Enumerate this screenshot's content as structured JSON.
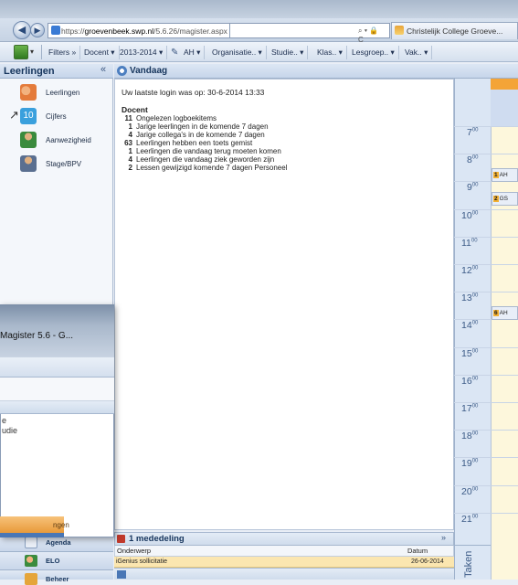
{
  "browser": {
    "url_prefix": "https://",
    "url_domain": "groevenbeek.swp.nl",
    "url_path": "/5.6.26/magister.aspx",
    "url_tools": "⌕ ▾ 🔒 C",
    "tab_title": "Christelijk College Groeve..."
  },
  "toolbar": {
    "items": [
      "Filters »",
      "Docent ▾",
      "2013-2014 ▾",
      "AH ▾",
      "Organisatie.. ▾",
      "Studie.. ▾",
      "Klas.. ▾",
      "Lesgroep.. ▾",
      "Vak.. ▾"
    ]
  },
  "sidebar": {
    "title": "Leerlingen",
    "collapse": "«",
    "items": [
      {
        "label": "Leerlingen",
        "icon": "students-icon",
        "color": "#e47b3b"
      },
      {
        "label": "Cijfers",
        "icon": "grades-icon",
        "color": "#3aa0dd"
      },
      {
        "label": "Aanwezigheid",
        "icon": "attendance-icon",
        "color": "#3a8b3d"
      },
      {
        "label": "Stage/BPV",
        "icon": "internship-icon",
        "color": "#5a6f90"
      }
    ],
    "bottom": [
      {
        "label": "Agenda",
        "icon": "calendar-icon"
      },
      {
        "label": "ELO",
        "icon": "elo-icon"
      },
      {
        "label": "Beheer",
        "icon": "admin-icon"
      }
    ]
  },
  "main": {
    "title": "Vandaag",
    "last_login": "Uw laatste login was op: 30-6-2014 13:33",
    "section": "Docent",
    "stats": [
      {
        "n": "11",
        "text": "Ongelezen logboekitems"
      },
      {
        "n": "1",
        "text": "Jarige leerlingen in de komende 7 dagen"
      },
      {
        "n": "4",
        "text": "Jarige collega's in de komende 7 dagen"
      },
      {
        "n": "63",
        "text": "Leerlingen hebben een toets gemist"
      },
      {
        "n": "1",
        "text": "Leerlingen die vandaag terug moeten komen"
      },
      {
        "n": "4",
        "text": "Leerlingen die vandaag ziek geworden zijn"
      },
      {
        "n": "2",
        "text": "Lessen gewijzigd komende 7 dagen Personeel"
      }
    ]
  },
  "mededeling": {
    "title": "1 mededeling",
    "col_subject": "Onderwerp",
    "col_date": "Datum",
    "rows": [
      {
        "subject": "iGenius sollicitatie",
        "date": "26-06-2014"
      }
    ]
  },
  "agenda": {
    "hours": [
      "7",
      "8",
      "9",
      "10",
      "11",
      "12",
      "13",
      "14",
      "15",
      "16",
      "17",
      "18",
      "19",
      "20",
      "21"
    ],
    "minutes": "00",
    "appointments": [
      {
        "num": "1",
        "text": "AH"
      },
      {
        "num": "2",
        "text": "GS"
      },
      {
        "num": "6",
        "text": "AH"
      }
    ],
    "taken_label": "Taken"
  },
  "overlay": {
    "title": "Magister 5.6 - G...",
    "text1": "e",
    "text2": "udie",
    "orange_label": "ngen"
  }
}
